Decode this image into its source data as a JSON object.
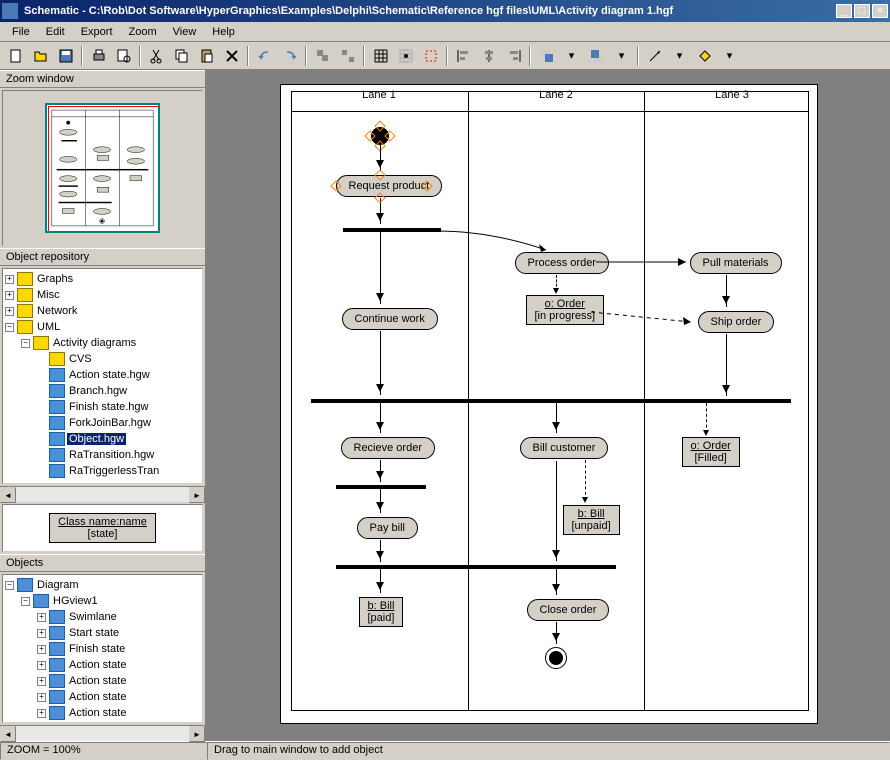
{
  "window": {
    "title": "Schematic - C:\\Rob\\Dot Software\\HyperGraphics\\Examples\\Delphi\\Schematic\\Reference hgf files\\UML\\Activity diagram 1.hgf"
  },
  "menu": {
    "file": "File",
    "edit": "Edit",
    "export": "Export",
    "zoom": "Zoom",
    "view": "View",
    "help": "Help"
  },
  "panels": {
    "zoom_window": "Zoom window",
    "object_repository": "Object repository",
    "objects": "Objects"
  },
  "repository": {
    "graphs": "Graphs",
    "misc": "Misc",
    "network": "Network",
    "uml": "UML",
    "activity_diagrams": "Activity diagrams",
    "cvs": "CVS",
    "action_state": "Action state.hgw",
    "branch": "Branch.hgw",
    "finish_state": "Finish state.hgw",
    "fork_join_bar": "ForkJoinBar.hgw",
    "object": "Object.hgw",
    "ra_transition": "RaTransition.hgw",
    "ra_triggerless": "RaTriggerlessTran"
  },
  "preview": {
    "line1": "Class name:name",
    "line2": "[state]"
  },
  "objects_tree": {
    "diagram": "Diagram",
    "hgview": "HGview1",
    "swimlane": "Swimlane",
    "start_state": "Start state",
    "finish_state": "Finish state",
    "action_state": "Action state"
  },
  "diagram": {
    "lane1": "Lane 1",
    "lane2": "Lane 2",
    "lane3": "Lane 3",
    "request_product": "Request product",
    "process_order": "Process order",
    "pull_materials": "Pull materials",
    "continue_work": "Continue work",
    "ship_order": "Ship order",
    "recieve_order": "Recieve order",
    "bill_customer": "Bill customer",
    "pay_bill": "Pay bill",
    "close_order": "Close order",
    "o_order": "o: Order",
    "in_progress": "[in progress]",
    "filled": "[Filled]",
    "b_bill": "b: Bill",
    "unpaid": "[unpaid]",
    "paid": "[paid]"
  },
  "status": {
    "zoom": "ZOOM = 100%",
    "hint": "Drag to main window to add object"
  }
}
